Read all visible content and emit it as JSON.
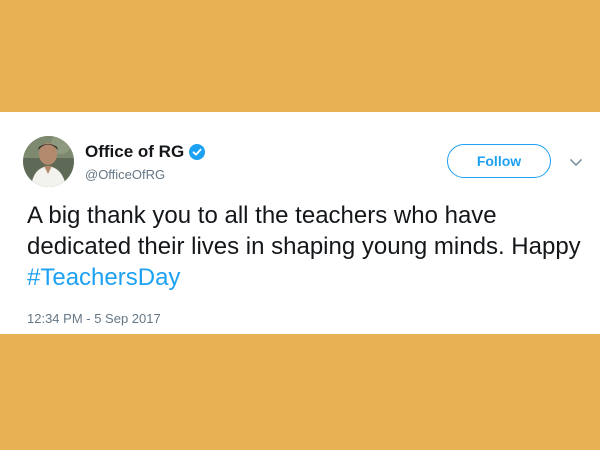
{
  "tweet": {
    "display_name": "Office of RG",
    "handle": "@OfficeOfRG",
    "follow_label": "Follow",
    "text_part1": "A big thank you to all the teachers who have dedicated their lives in shaping young minds. Happy ",
    "hashtag": "#TeachersDay",
    "timestamp": "12:34 PM - 5 Sep 2017"
  },
  "colors": {
    "background": "#E8B153",
    "card": "#FFFFFF",
    "accent": "#1DA1F2",
    "text": "#14171A",
    "muted": "#657786"
  },
  "icons": {
    "verified": "verified-badge-icon",
    "menu": "chevron-down-icon"
  }
}
